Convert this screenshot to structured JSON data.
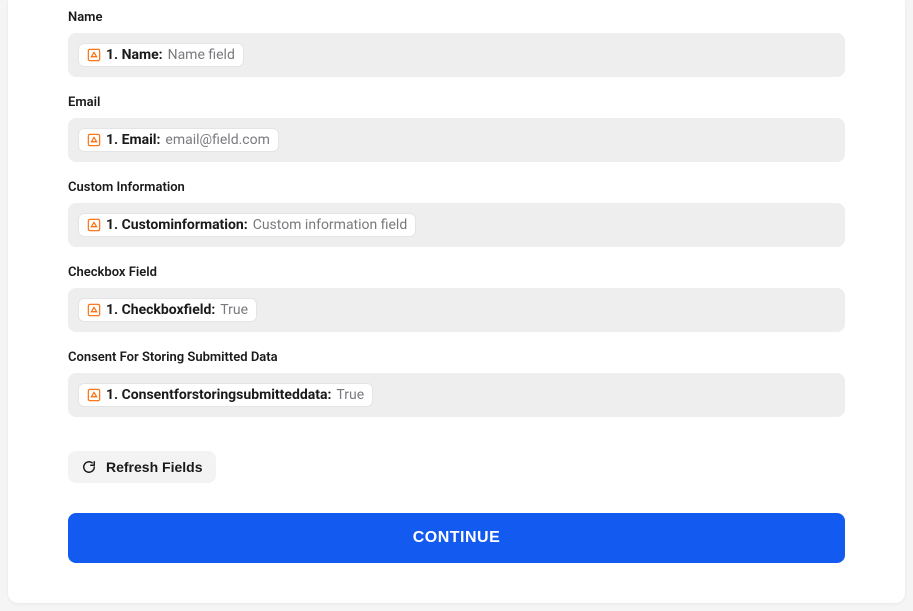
{
  "fields": [
    {
      "label": "Name",
      "pillKey": "1. Name:",
      "pillValue": "Name field"
    },
    {
      "label": "Email",
      "pillKey": "1. Email:",
      "pillValue": "email@field.com"
    },
    {
      "label": "Custom Information",
      "pillKey": "1. Custominformation:",
      "pillValue": "Custom information field"
    },
    {
      "label": "Checkbox Field",
      "pillKey": "1. Checkboxfield:",
      "pillValue": "True"
    },
    {
      "label": "Consent For Storing Submitted Data",
      "pillKey": "1. Consentforstoringsubmitteddata:",
      "pillValue": "True"
    }
  ],
  "buttons": {
    "refresh": "Refresh Fields",
    "continue": "CONTINUE"
  }
}
